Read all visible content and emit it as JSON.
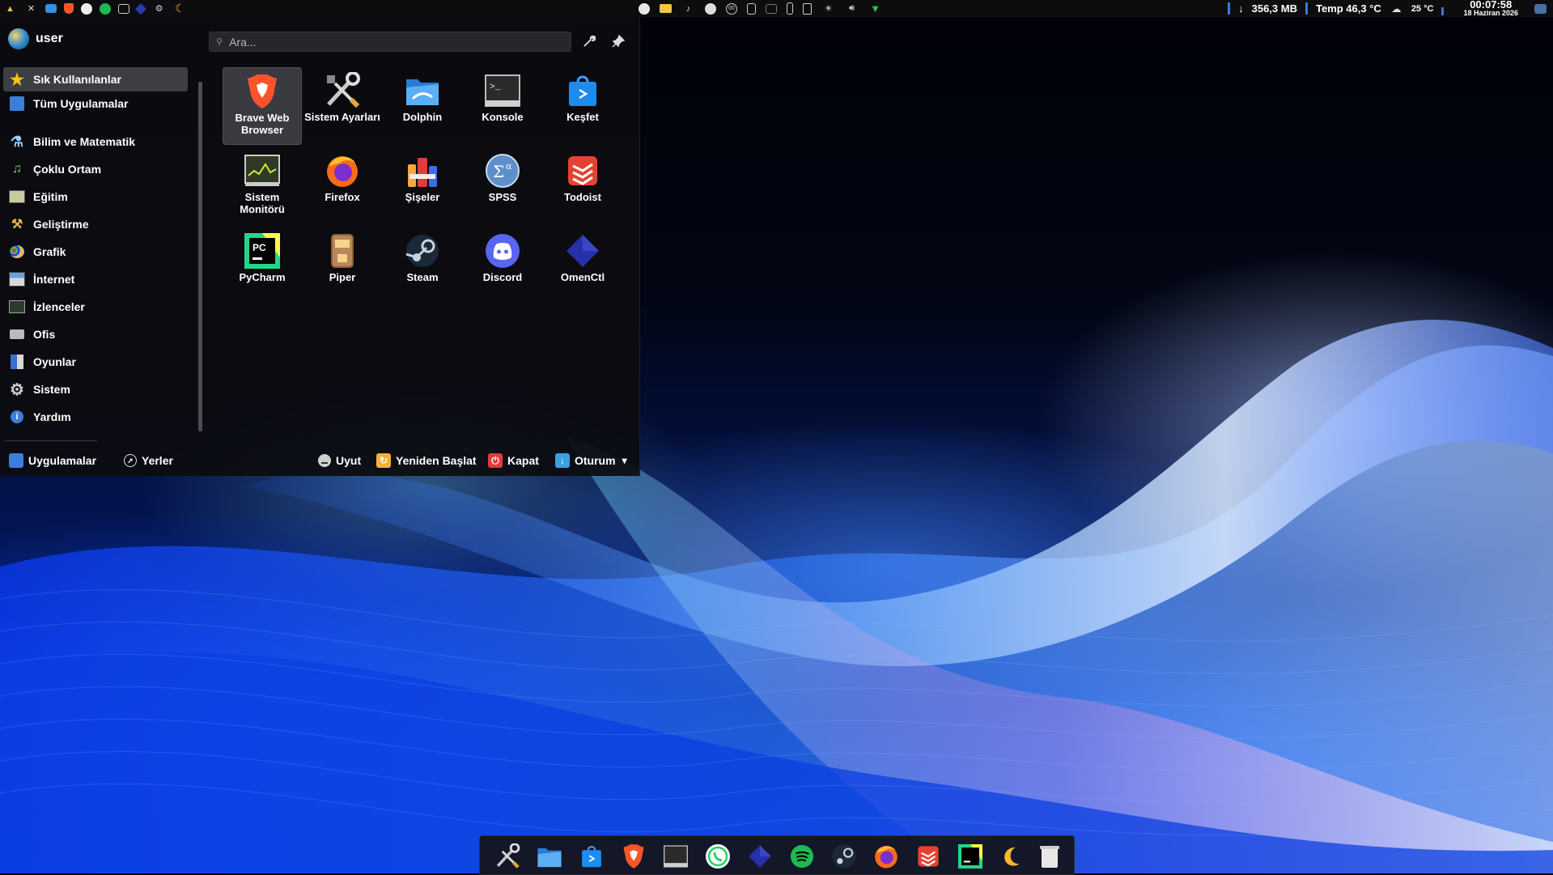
{
  "top_panel": {
    "tray_left": [
      "launcher-flask",
      "system-settings",
      "dolphin",
      "brave",
      "whatsapp",
      "spotify",
      "system-monitor",
      "omenctl",
      "steam",
      "night-light"
    ],
    "tray_center": [
      "whatsapp",
      "folder",
      "notifications",
      "steam",
      "kdeconnect",
      "clipboard",
      "display",
      "battery",
      "device",
      "brightness",
      "volume",
      "network"
    ],
    "network_arrow": "↓",
    "memory": "356,3 MB",
    "temp": "Temp 46,3 °C",
    "weather_icon": "cloud-icon",
    "weather_temp": "25 °C",
    "clock_time": "00:07:58",
    "clock_date": "18 Haziran 2026"
  },
  "launcher": {
    "username": "user",
    "search_placeholder": "Ara...",
    "categories": [
      {
        "label": "Sık Kullanılanlar",
        "icon": "star-icon",
        "active": true
      },
      {
        "label": "Tüm Uygulamalar",
        "icon": "grid-icon",
        "active": false
      },
      {
        "label": "Bilim ve Matematik",
        "icon": "flask-icon",
        "active": false
      },
      {
        "label": "Çoklu Ortam",
        "icon": "multimedia-icon",
        "active": false
      },
      {
        "label": "Eğitim",
        "icon": "education-icon",
        "active": false
      },
      {
        "label": "Geliştirme",
        "icon": "hammer-icon",
        "active": false
      },
      {
        "label": "Grafik",
        "icon": "palette-icon",
        "active": false
      },
      {
        "label": "İnternet",
        "icon": "internet-icon",
        "active": false
      },
      {
        "label": "İzlenceler",
        "icon": "utilities-icon",
        "active": false
      },
      {
        "label": "Ofis",
        "icon": "office-icon",
        "active": false
      },
      {
        "label": "Oyunlar",
        "icon": "games-icon",
        "active": false
      },
      {
        "label": "Sistem",
        "icon": "gear-icon",
        "active": false
      },
      {
        "label": "Yardım",
        "icon": "help-icon",
        "active": false
      }
    ],
    "apps": [
      {
        "label": "Brave Web Browser",
        "icon": "brave-icon",
        "selected": true
      },
      {
        "label": "Sistem Ayarları",
        "icon": "tools-icon",
        "selected": false
      },
      {
        "label": "Dolphin",
        "icon": "folder-icon",
        "selected": false
      },
      {
        "label": "Konsole",
        "icon": "terminal-icon",
        "selected": false
      },
      {
        "label": "Keşfet",
        "icon": "store-icon",
        "selected": false
      },
      {
        "label": "Sistem Monitörü",
        "icon": "monitor-icon",
        "selected": false
      },
      {
        "label": "Firefox",
        "icon": "firefox-icon",
        "selected": false
      },
      {
        "label": "Şişeler",
        "icon": "bottles-icon",
        "selected": false
      },
      {
        "label": "SPSS",
        "icon": "spss-icon",
        "selected": false
      },
      {
        "label": "Todoist",
        "icon": "todoist-icon",
        "selected": false
      },
      {
        "label": "PyCharm",
        "icon": "pycharm-icon",
        "selected": false
      },
      {
        "label": "Piper",
        "icon": "piper-icon",
        "selected": false
      },
      {
        "label": "Steam",
        "icon": "steam-icon",
        "selected": false
      },
      {
        "label": "Discord",
        "icon": "discord-icon",
        "selected": false
      },
      {
        "label": "OmenCtl",
        "icon": "omenctl-icon",
        "selected": false
      }
    ],
    "bottom": {
      "applications": "Uygulamalar",
      "places": "Yerler",
      "sleep": "Uyut",
      "restart": "Yeniden Başlat",
      "shutdown": "Kapat",
      "session": "Oturum",
      "session_caret": "▾"
    }
  },
  "dock": {
    "items": [
      "tools-icon",
      "folder-icon",
      "store-icon",
      "brave-icon",
      "terminal-icon",
      "whatsapp-icon",
      "omenctl-icon",
      "spotify-icon",
      "steam-icon",
      "firefox-icon",
      "todoist-icon",
      "pycharm-icon",
      "night-light-icon",
      "trash-icon"
    ]
  },
  "colors": {
    "accent": "#3a7bd5",
    "panel_bg": "#0d0d10",
    "menu_bg": "#0c0c10"
  }
}
